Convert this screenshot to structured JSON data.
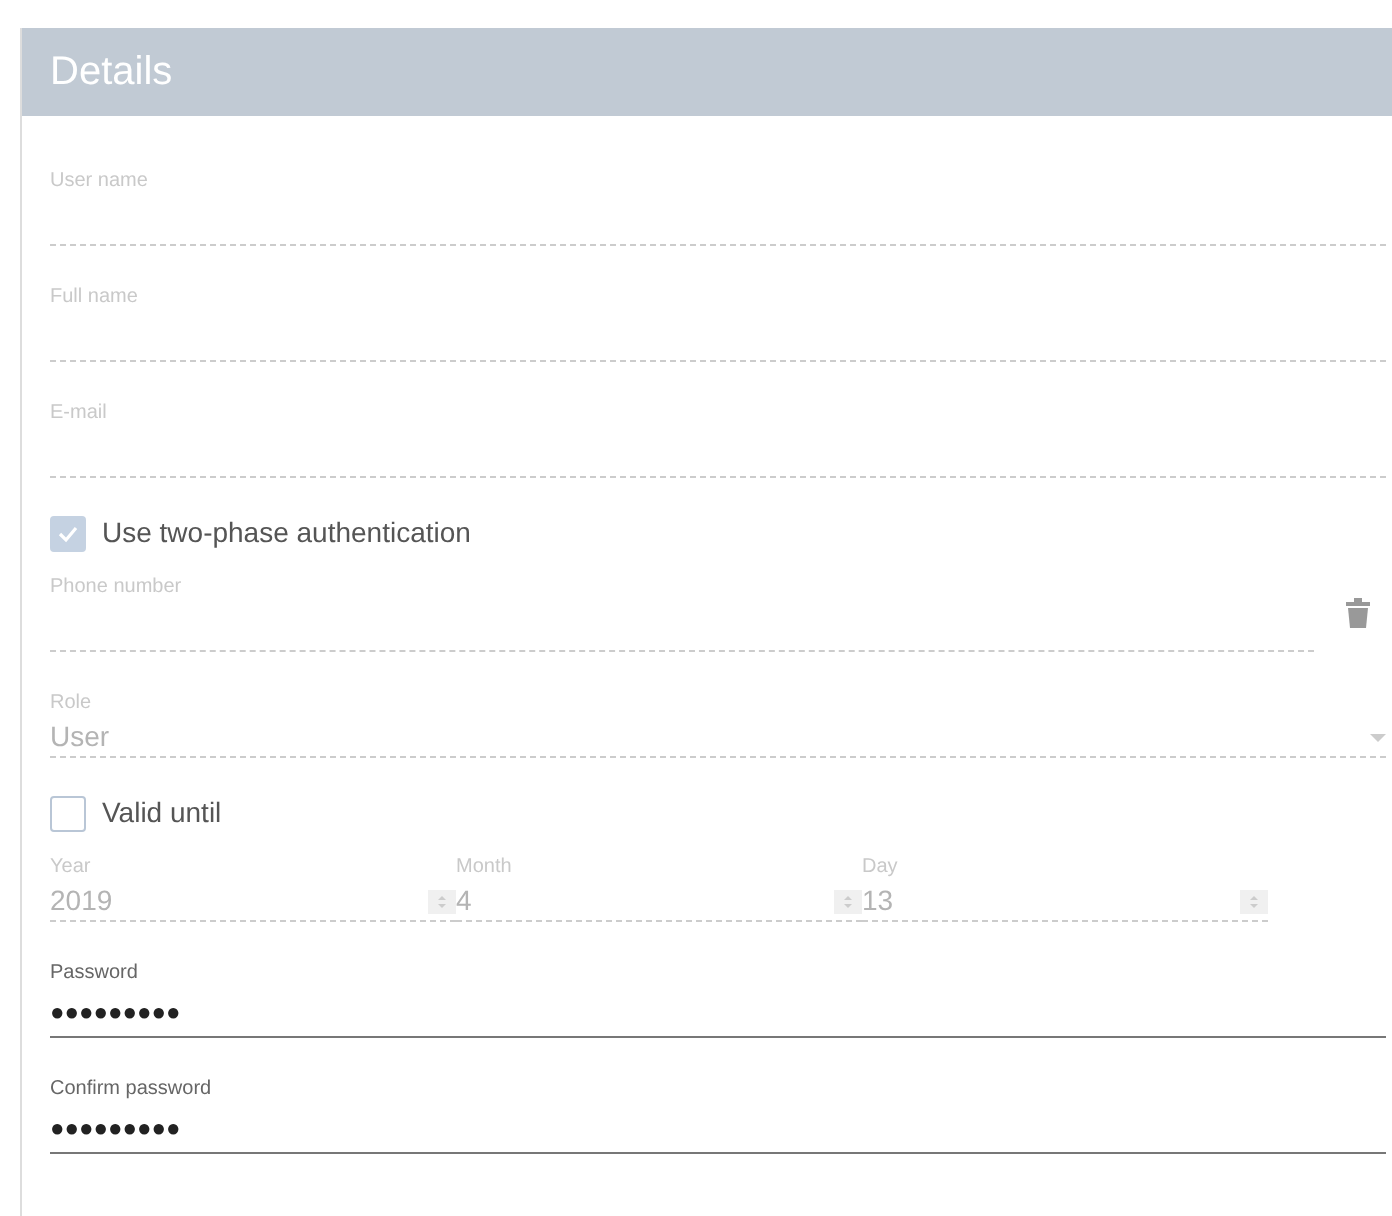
{
  "panel": {
    "title": "Details"
  },
  "items": [
    {
      "kind": "text",
      "label": "User name",
      "value": "",
      "disabled": true
    },
    {
      "kind": "text",
      "label": "Full name",
      "value": "",
      "disabled": true
    },
    {
      "kind": "text",
      "label": "E-mail",
      "value": "",
      "disabled": true
    },
    {
      "kind": "checkbox",
      "label": "Use two-phase authentication",
      "checked": true
    },
    {
      "kind": "phone",
      "label": "Phone number",
      "disabled": true
    },
    {
      "kind": "select",
      "label": "Role",
      "value": "User",
      "disabled": true
    },
    {
      "kind": "checkbox",
      "label": "Valid until",
      "checked": false
    },
    {
      "kind": "date",
      "disabled": true,
      "parts": [
        {
          "label": "Year",
          "value": "2019"
        },
        {
          "label": "Month",
          "value": "4"
        },
        {
          "label": "Day",
          "value": "13"
        }
      ]
    },
    {
      "kind": "text",
      "label": "Password",
      "value": "●●●●●●●●●",
      "disabled": false
    },
    {
      "kind": "text",
      "label": "Confirm password",
      "value": "●●●●●●●●●",
      "disabled": false
    }
  ]
}
